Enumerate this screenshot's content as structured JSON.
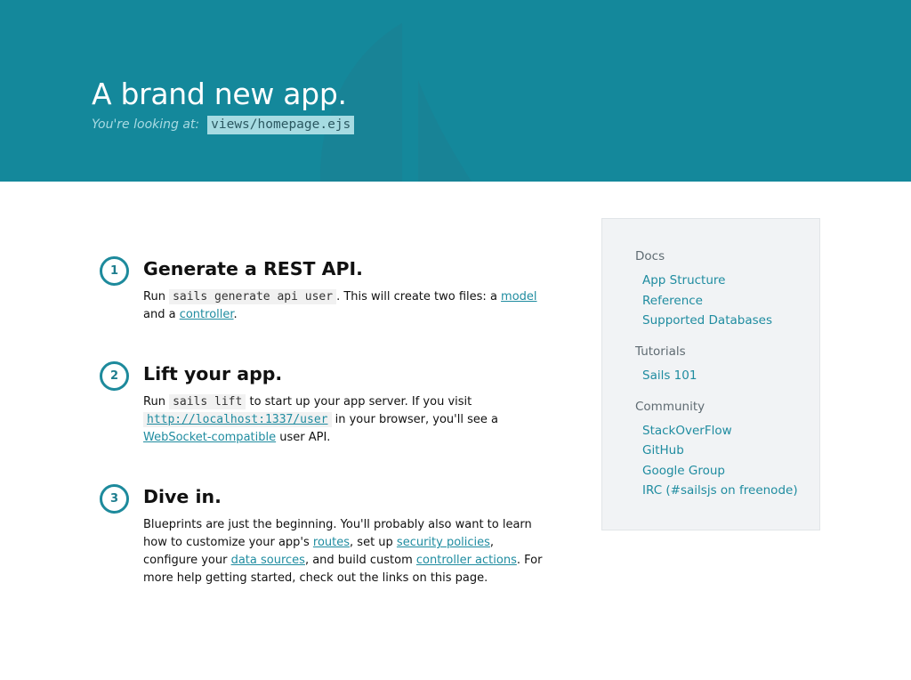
{
  "hero": {
    "title": "A brand new app.",
    "subtitle_label": "You're looking at:",
    "subtitle_file": "views/homepage.ejs",
    "bg_color": "#14889b"
  },
  "steps": [
    {
      "number": "1",
      "title": "Generate a REST API.",
      "body": {
        "t1": "Run ",
        "code1": "sails generate api user",
        "t2": ". This will create two files: a ",
        "link1": "model",
        "t3": "and a ",
        "link2": "controller",
        "t4": "."
      }
    },
    {
      "number": "2",
      "title": "Lift your app.",
      "body": {
        "t1": "Run ",
        "code1": "sails lift",
        "t2": " to start up your app server. If you visit",
        "link1": "http://localhost:1337/user",
        "t3": " in your browser, you'll see a",
        "link2": "WebSocket-compatible",
        "t4": " user API."
      }
    },
    {
      "number": "3",
      "title": "Dive in.",
      "body": {
        "t1": "Blueprints are just the beginning. You'll probably also want to learn how to customize your app's ",
        "link1": "routes",
        "t2": ", set up ",
        "link2": "security policies",
        "t3": ", configure your ",
        "link3": "data sources",
        "t4": ", and build custom ",
        "link4": "controller actions",
        "t5": ". For more help getting started, check out the links on this page."
      }
    }
  ],
  "sidebar": {
    "sections": [
      {
        "heading": "Docs",
        "links": [
          "App Structure",
          "Reference",
          "Supported Databases"
        ]
      },
      {
        "heading": "Tutorials",
        "links": [
          "Sails 101"
        ]
      },
      {
        "heading": "Community",
        "links": [
          "StackOverFlow",
          "GitHub",
          "Google Group",
          "IRC (#sailsjs on freenode)"
        ]
      }
    ]
  },
  "colors": {
    "accent": "#1f8ca0",
    "sidebar_bg": "#f1f3f5"
  }
}
